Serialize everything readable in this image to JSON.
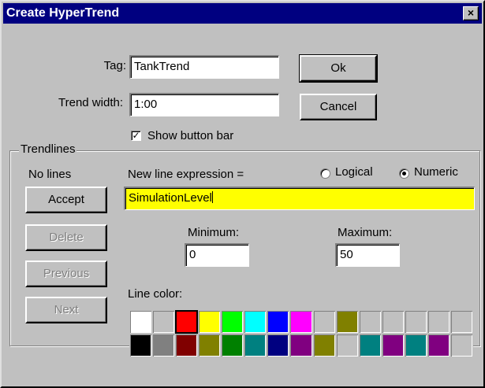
{
  "window": {
    "title": "Create HyperTrend",
    "close_glyph": "×"
  },
  "tag": {
    "label": "Tag:",
    "value": "TankTrend"
  },
  "trend_width": {
    "label": "Trend width:",
    "value": "1:00"
  },
  "show_button_bar": {
    "label": "Show button bar",
    "checked": true
  },
  "buttons": {
    "ok": "Ok",
    "cancel": "Cancel"
  },
  "trendlines": {
    "group_title": "Trendlines",
    "status": "No lines",
    "accept": "Accept",
    "delete": "Delete",
    "previous": "Previous",
    "next": "Next",
    "expression_label": "New line expression =",
    "expression_value": "SimulationLevel",
    "expression_bg": "#ffff00",
    "mode": {
      "logical": "Logical",
      "numeric": "Numeric",
      "selected": "numeric"
    },
    "minimum": {
      "label": "Minimum:",
      "value": "0"
    },
    "maximum": {
      "label": "Maximum:",
      "value": "50"
    },
    "line_color": {
      "label": "Line color:",
      "selected_index": 2,
      "palette": [
        "#ffffff",
        "#c0c0c0",
        "#ff0000",
        "#ffff00",
        "#00ff00",
        "#00ffff",
        "#0000ff",
        "#ff00ff",
        "#c0c0c0",
        "#808000",
        "#c0c0c0",
        "#c0c0c0",
        "#c0c0c0",
        "#c0c0c0",
        "#c0c0c0",
        "#000000",
        "#808080",
        "#800000",
        "#808000",
        "#008000",
        "#008080",
        "#000080",
        "#800080",
        "#808000",
        "#c0c0c0",
        "#008080",
        "#800080",
        "#008080",
        "#800080",
        "#c0c0c0"
      ]
    }
  }
}
